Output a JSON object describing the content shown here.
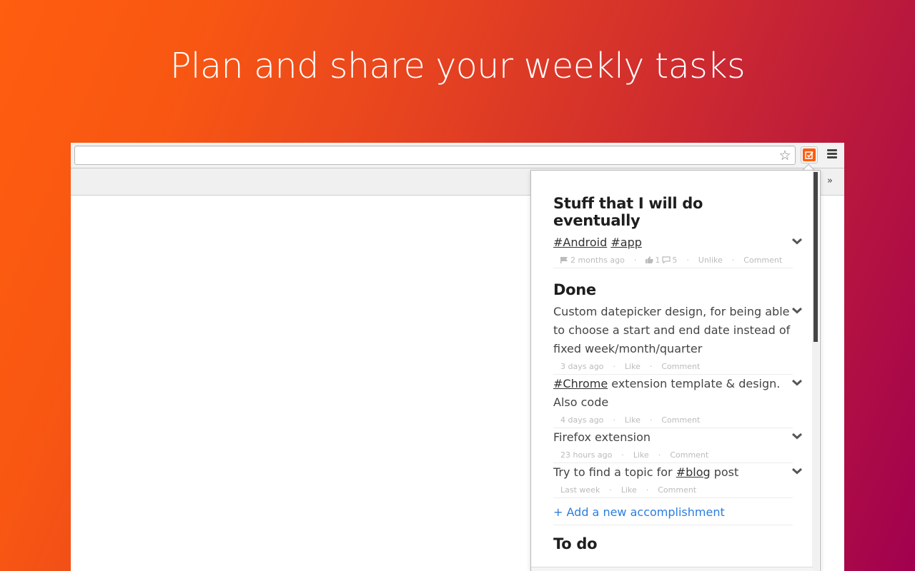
{
  "headline": "Plan and share your weekly tasks",
  "colors": {
    "brand": "#ff5d0f",
    "gradient_start": "#ff5d0f",
    "gradient_end": "#a1004f",
    "link": "#2b7de0"
  },
  "browser": {
    "omnibox": {
      "value": "",
      "placeholder": ""
    },
    "icons": {
      "bookmark": "star-icon",
      "extension": "checkbox-icon",
      "menu": "hamburger-menu-icon",
      "overflow": "double-chevron-right-icon"
    },
    "overflow_label": "»"
  },
  "popup": {
    "sections": [
      {
        "title": "Stuff that I will do eventually",
        "items": [
          {
            "parts": [
              {
                "text": "#Android",
                "tag": true
              },
              {
                "text": " ",
                "tag": false
              },
              {
                "text": "#app",
                "tag": true
              }
            ],
            "time": "2 months ago",
            "likes": "1",
            "comments": "5",
            "like_action": "Unlike",
            "comment_action": "Comment"
          }
        ]
      },
      {
        "title": "Done",
        "items": [
          {
            "parts": [
              {
                "text": "Custom datepicker design, for being able to choose a start and end date instead of fixed week/month/quarter",
                "tag": false
              }
            ],
            "time": "3 days ago",
            "like_action": "Like",
            "comment_action": "Comment"
          },
          {
            "parts": [
              {
                "text": "#Chrome",
                "tag": true
              },
              {
                "text": " extension template & design. Also code",
                "tag": false
              }
            ],
            "time": "4 days ago",
            "like_action": "Like",
            "comment_action": "Comment"
          },
          {
            "parts": [
              {
                "text": "Firefox extension",
                "tag": false
              }
            ],
            "time": "23 hours ago",
            "like_action": "Like",
            "comment_action": "Comment"
          },
          {
            "parts": [
              {
                "text": "Try to find a topic for ",
                "tag": false
              },
              {
                "text": "#blog",
                "tag": true
              },
              {
                "text": " post",
                "tag": false
              }
            ],
            "time": "Last week",
            "like_action": "Like",
            "comment_action": "Comment"
          }
        ],
        "add_label": "+ Add a new accomplishment"
      },
      {
        "title": "To do",
        "items": []
      }
    ],
    "separator": "·"
  }
}
